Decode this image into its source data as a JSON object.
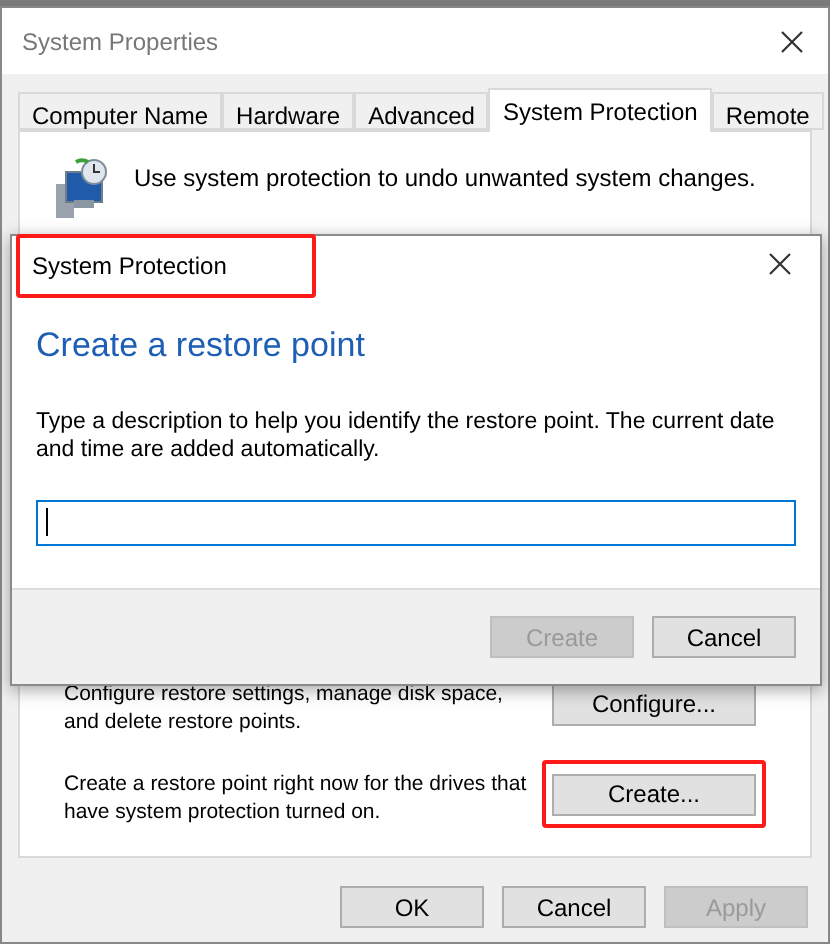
{
  "window": {
    "title": "System Properties"
  },
  "tabs": [
    {
      "label": "Computer Name",
      "selected": false
    },
    {
      "label": "Hardware",
      "selected": false
    },
    {
      "label": "Advanced",
      "selected": false
    },
    {
      "label": "System Protection",
      "selected": true
    },
    {
      "label": "Remote",
      "selected": false
    }
  ],
  "intro": "Use system protection to undo unwanted system changes.",
  "actions": [
    {
      "text": "Configure restore settings, manage disk space, and delete restore points.",
      "button": "Configure...",
      "highlighted": false
    },
    {
      "text": "Create a restore point right now for the drives that have system protection turned on.",
      "button": "Create...",
      "highlighted": true
    }
  ],
  "buttons": [
    {
      "label": "OK",
      "disabled": false
    },
    {
      "label": "Cancel",
      "disabled": false
    },
    {
      "label": "Apply",
      "disabled": true
    }
  ],
  "dialog": {
    "title": "System Protection",
    "title_highlighted": true,
    "heading": "Create a restore point",
    "description": "Type a description to help you identify the restore point. The current date and time are added automatically.",
    "input": {
      "placeholder_caret": true
    },
    "buttons": [
      {
        "label": "Create",
        "disabled": true
      },
      {
        "label": "Cancel",
        "disabled": false
      }
    ]
  }
}
